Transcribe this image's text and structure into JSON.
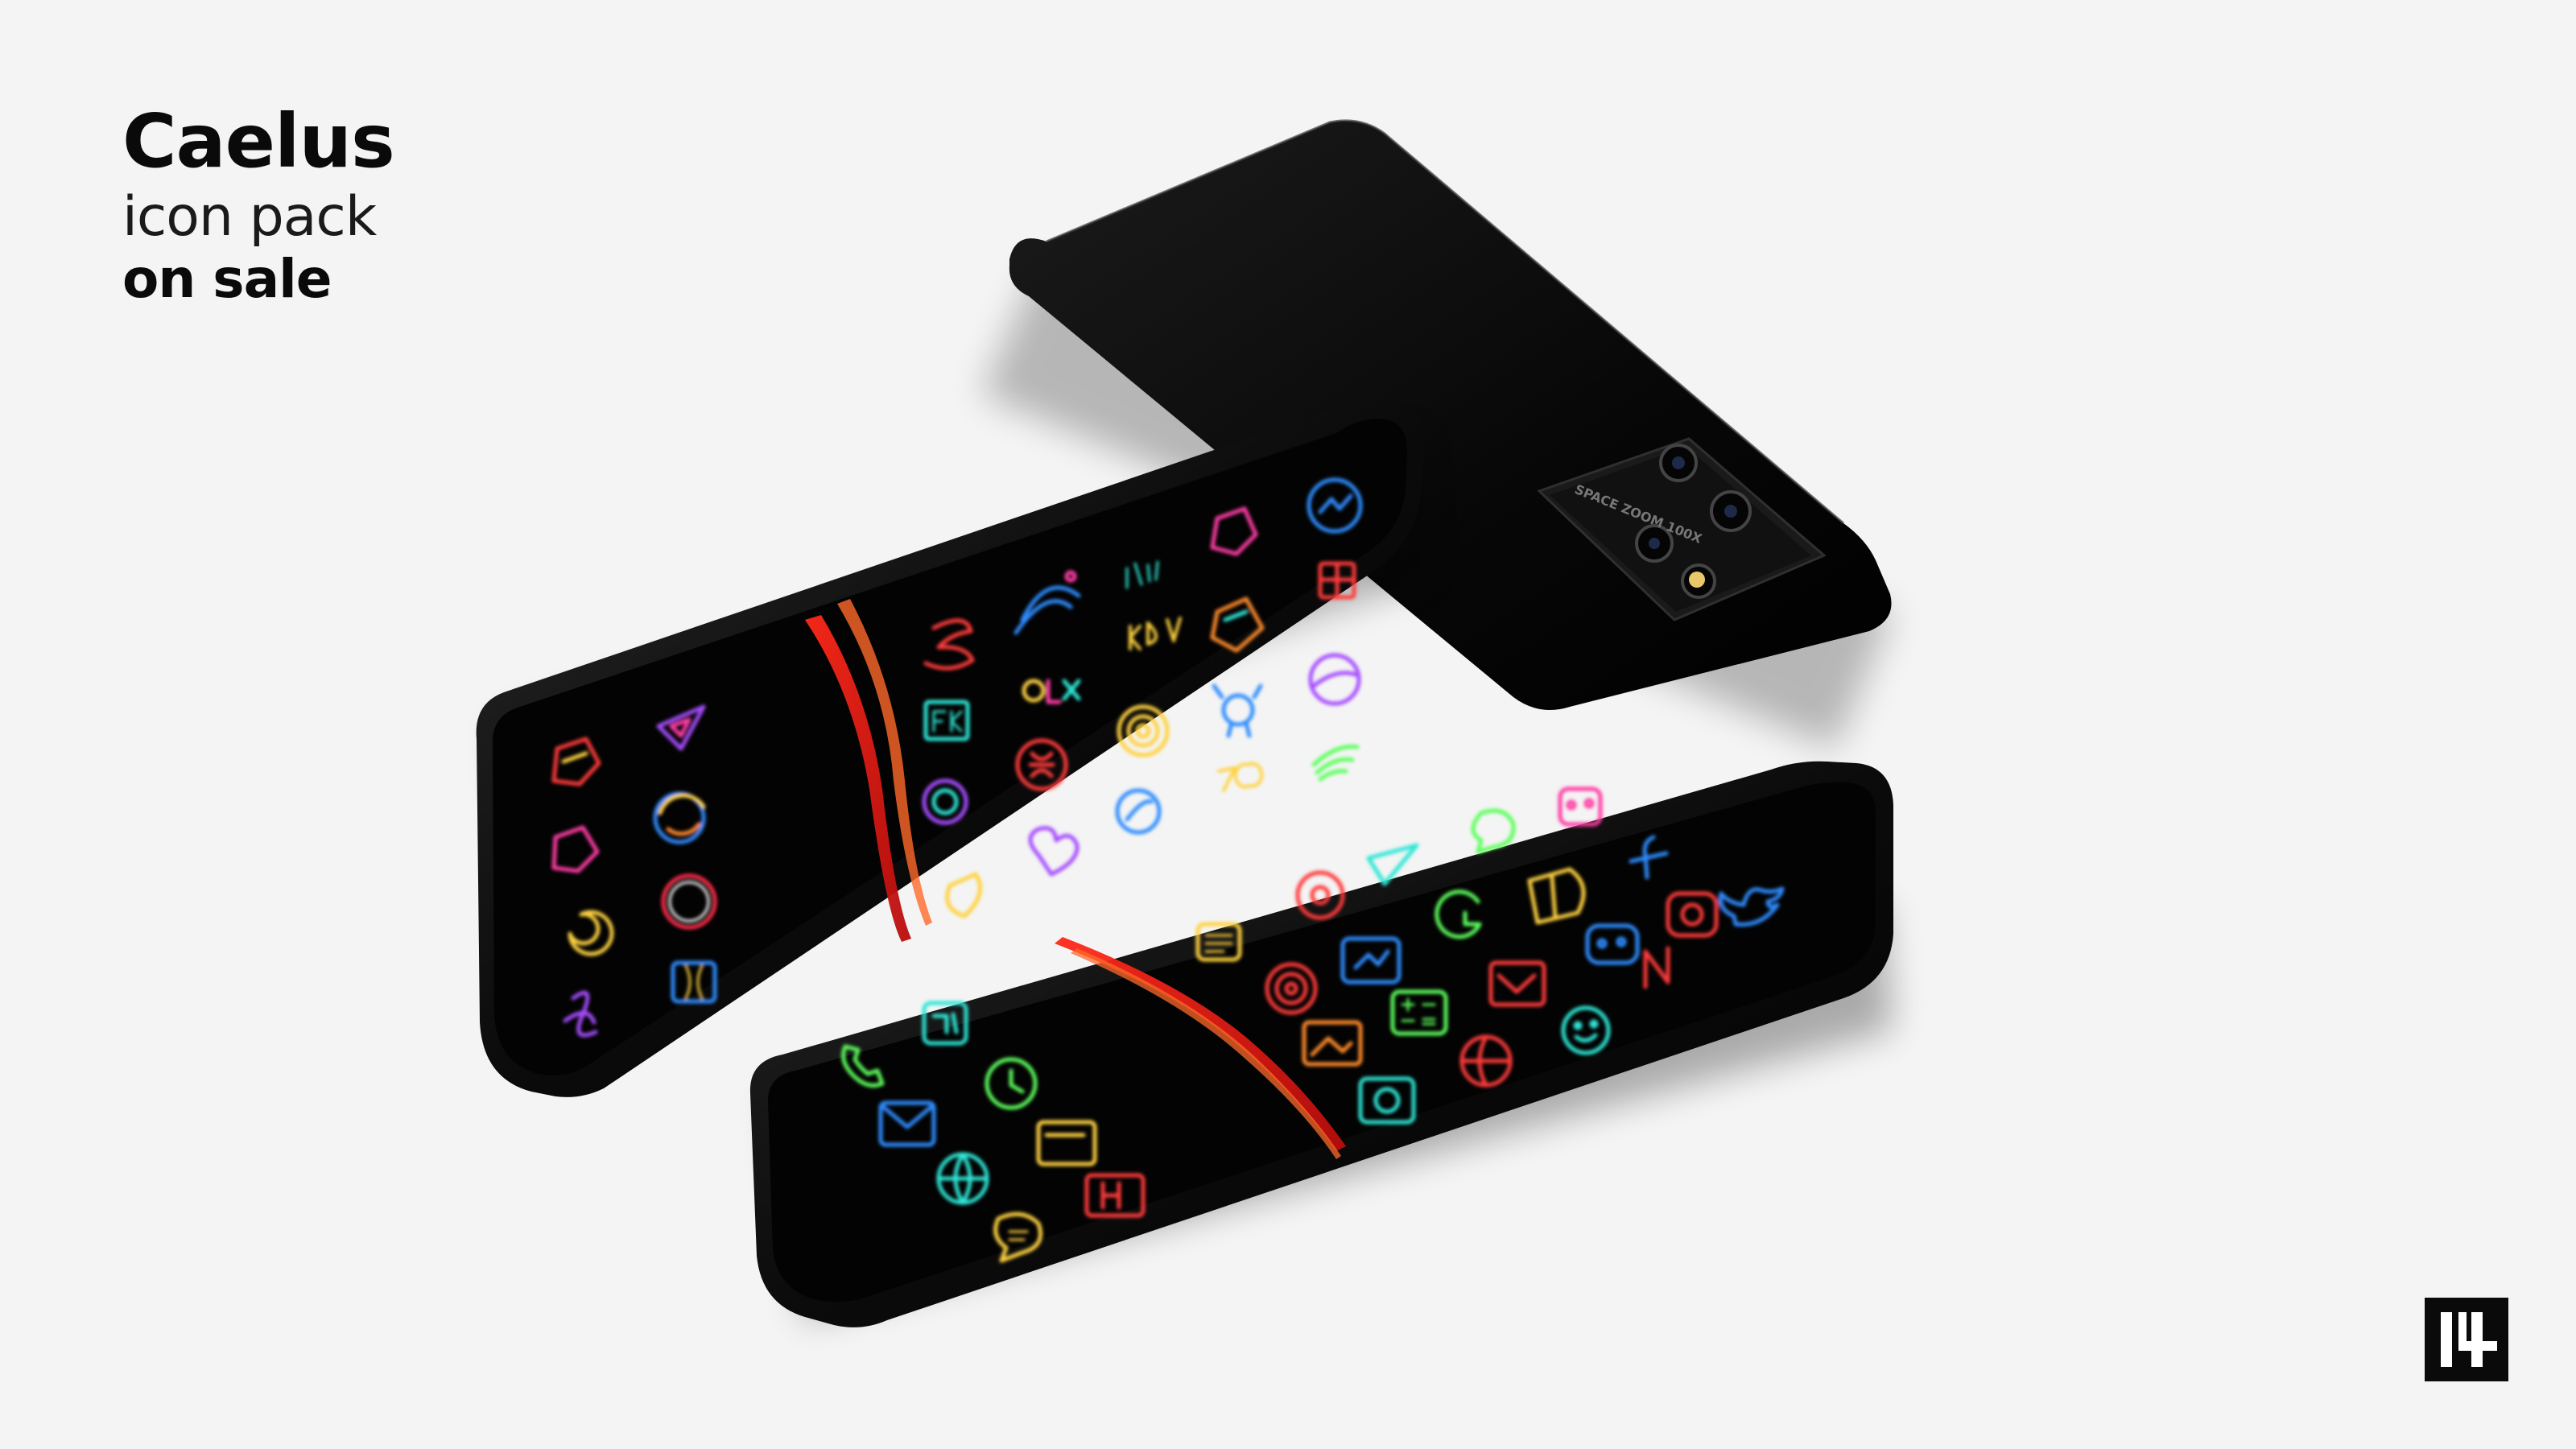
{
  "headline": {
    "title": "Caelus",
    "subtitle": "icon pack",
    "tagline": "on sale"
  },
  "brand": {
    "logo_text": "14",
    "icon": "brand-logo-icon"
  },
  "camera": {
    "module_text": "SPACE ZOOM 100X"
  },
  "colors": {
    "background": "#f4f4f4",
    "phone_body": "#0b0b0b",
    "screen": "#030303",
    "neon_red": "#ff3b3b",
    "neon_pink": "#ff3ea5",
    "neon_purple": "#a64dff",
    "neon_blue": "#2f8cff",
    "neon_cyan": "#2fe6d6",
    "neon_green": "#5cff5c",
    "neon_yellow": "#ffd23f",
    "neon_orange": "#ff8a2a"
  },
  "phones": [
    {
      "name": "back-phone",
      "view": "rear"
    },
    {
      "name": "middle-phone",
      "view": "screen",
      "icons": [
        "hexagon-icon",
        "triangle-play-icon",
        "circle-icon",
        "swirl-icon",
        "letter-s-icon",
        "wave-icon",
        "text-logo-icon",
        "kdv-icon",
        "fk-icon",
        "olx-icon",
        "spiral-icon",
        "heart-icon",
        "pin-icon",
        "bug-icon",
        "shield-icon",
        "signal-icon"
      ]
    },
    {
      "name": "front-phone",
      "view": "screen",
      "icons": [
        "phone-icon",
        "clock-icon",
        "mail-icon",
        "globe-icon",
        "gallery-icon",
        "calendar-icon",
        "chat-icon",
        "music-icon",
        "camera-icon",
        "calculator-icon",
        "basketball-icon",
        "netflix-icon",
        "twitter-icon",
        "facebook-icon",
        "instagram-icon",
        "robot-icon"
      ]
    }
  ]
}
